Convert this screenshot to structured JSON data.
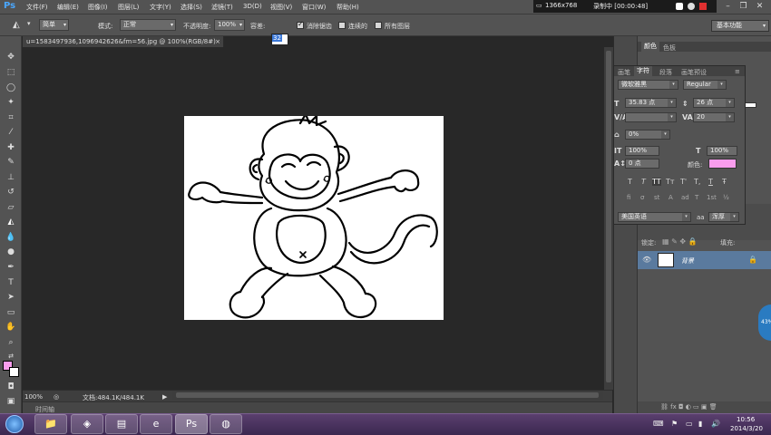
{
  "menubar": {
    "logo": "Ps",
    "items": [
      "文件(F)",
      "编辑(E)",
      "图像(I)",
      "图层(L)",
      "文字(Y)",
      "选择(S)",
      "滤镜(T)",
      "3D(D)",
      "视图(V)",
      "窗口(W)",
      "帮助(H)"
    ],
    "recorder": {
      "resolution": "1366x768",
      "status": "录制中 [00:00:48]"
    },
    "window_controls": [
      "–",
      "❐",
      "✕"
    ]
  },
  "options": {
    "sample_label": "简单",
    "mode_label": "模式:",
    "mode_value": "正常",
    "opacity_label": "不透明度:",
    "opacity_value": "100%",
    "tolerance_label": "容差:",
    "tolerance_value": "32",
    "antialias_label": "消除锯齿",
    "antialias_checked": true,
    "contiguous_label": "连续的",
    "contiguous_checked": false,
    "all_layers_label": "所有图层",
    "all_layers_checked": false,
    "workspace": "基本功能"
  },
  "document": {
    "tab_title": "u=1583497936,1096942626&fm=56.jpg @ 100%(RGB/8#)",
    "tab_close": "×"
  },
  "status": {
    "zoom": "100%",
    "doc_size": "文档:484.1K/484.1K",
    "timeline": "时间轴"
  },
  "panels": {
    "top_tabs": [
      "颜色",
      "色板"
    ],
    "char_tabs": [
      "画笔",
      "字符",
      "段落",
      "画笔预设"
    ],
    "font_family": "微软雅黑",
    "font_style": "Regular",
    "font_size": "35.83 点",
    "leading": "26 点",
    "kerning": "",
    "tracking": "20",
    "scale_v_percent": "0%",
    "vertical_scale": "100%",
    "horizontal_scale": "100%",
    "baseline_shift": "0 点",
    "color_label": "颜色:",
    "text_color": "#f99ded",
    "style_buttons": [
      "T",
      "T",
      "TT",
      "Tт",
      "T'",
      "T,",
      "T",
      "Ŧ"
    ],
    "opentype_buttons": [
      "fi",
      "σ",
      "st",
      "A",
      "ad",
      "T",
      "1st",
      "½"
    ],
    "language": "美国英语",
    "aa_label": "aa",
    "aa_value": "浑厚",
    "layers": {
      "lock_label": "锁定:",
      "fill_label": "填充:",
      "layer_name": "背景"
    }
  },
  "badge": "43%",
  "taskbar": {
    "time": "10:56",
    "date": "2014/3/20"
  },
  "colors": {
    "foreground": "#f99ded",
    "background": "#ffffff",
    "ui_dark": "#535353",
    "canvas_bg": "#282828"
  }
}
